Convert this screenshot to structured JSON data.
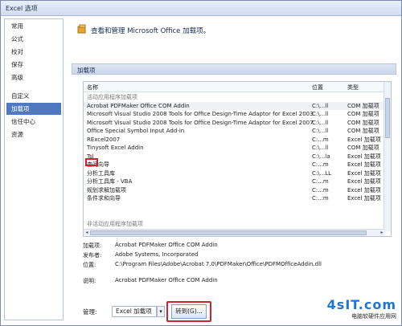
{
  "window": {
    "title": "Excel 选项"
  },
  "sidebar": {
    "items": [
      {
        "label": "常用",
        "selected": false
      },
      {
        "label": "公式",
        "selected": false
      },
      {
        "label": "校对",
        "selected": false
      },
      {
        "label": "保存",
        "selected": false
      },
      {
        "label": "高级",
        "selected": false
      },
      {
        "label": "自定义",
        "selected": false
      },
      {
        "label": "加载项",
        "selected": true
      },
      {
        "label": "信任中心",
        "selected": false
      },
      {
        "label": "资源",
        "selected": false
      }
    ]
  },
  "main": {
    "header": {
      "text": "查看和管理 Microsoft Office 加载项。"
    },
    "group_label": "加载项",
    "columns": {
      "name": "名称",
      "location": "位置",
      "type": "类型"
    },
    "rows": [
      {
        "name": "活动应用程序加载项",
        "location": "",
        "type": "",
        "section": true
      },
      {
        "name": "Acrobat PDFMaker Office COM Addin",
        "location": "C:\\...ll",
        "type": "COM 加载项",
        "highlight": true
      },
      {
        "name": "Microsoft Visual Studio 2008 Tools for Office Design-Time Adaptor for Excel 2003",
        "location": "C:\\...ll",
        "type": "COM 加载项"
      },
      {
        "name": "Microsoft Visual Studio 2008 Tools for Office Design-Time Adaptor for Excel 2007",
        "location": "C:\\...ll",
        "type": "COM 加载项"
      },
      {
        "name": "Office Special Symbol Input Add-in",
        "location": "C:\\...ll",
        "type": "COM 加载项"
      },
      {
        "name": "RExcel2007",
        "location": "C:...m",
        "type": "Excel 加载项"
      },
      {
        "name": "Tinysoft Excel Addin",
        "location": "C:\\...ll",
        "type": "COM 加载项"
      },
      {
        "name": "Tsl",
        "location": "C:\\...la",
        "type": "Excel 加载项"
      },
      {
        "name": "查阅向导",
        "location": "C:...m",
        "type": "Excel 加载项"
      },
      {
        "name": "分析工具库",
        "location": "C:\\...LL",
        "type": "Excel 加载项"
      },
      {
        "name": "分析工具库 - VBA",
        "location": "C:...m",
        "type": "Excel 加载项"
      },
      {
        "name": "规划求解加载项",
        "location": "C:...m",
        "type": "Excel 加载项"
      },
      {
        "name": "条件求和向导",
        "location": "C:...m",
        "type": "Excel 加载项"
      },
      {
        "name": "",
        "location": "",
        "type": ""
      },
      {
        "name": "",
        "location": "",
        "type": ""
      },
      {
        "name": "非活动应用程序加载项",
        "location": "",
        "type": "",
        "section": true
      }
    ],
    "details": {
      "addin_label": "加载项:",
      "addin_value": "Acrobat PDFMaker Office COM Addin",
      "publisher_label": "发布者:",
      "publisher_value": "Adobe Systems, Incorporated",
      "location_label": "位置:",
      "location_value": "C:\\Program Files\\Adobe\\Acrobat 7.0\\PDFMaker\\Office\\PDFMOfficeAddin.dll",
      "desc_label": "说明:",
      "desc_value": "Acrobat PDFMaker Office COM Addin"
    },
    "manage": {
      "label": "管理:",
      "selected": "Excel 加载项",
      "goto_label": "转到(G)..."
    }
  },
  "watermark": {
    "brand": "4sIT.com",
    "sub": "电脑软硬件应用网"
  },
  "colors": {
    "accent": "#4f78c0",
    "highlight_red": "#c6262e",
    "brand_blue": "#1e76d4"
  }
}
